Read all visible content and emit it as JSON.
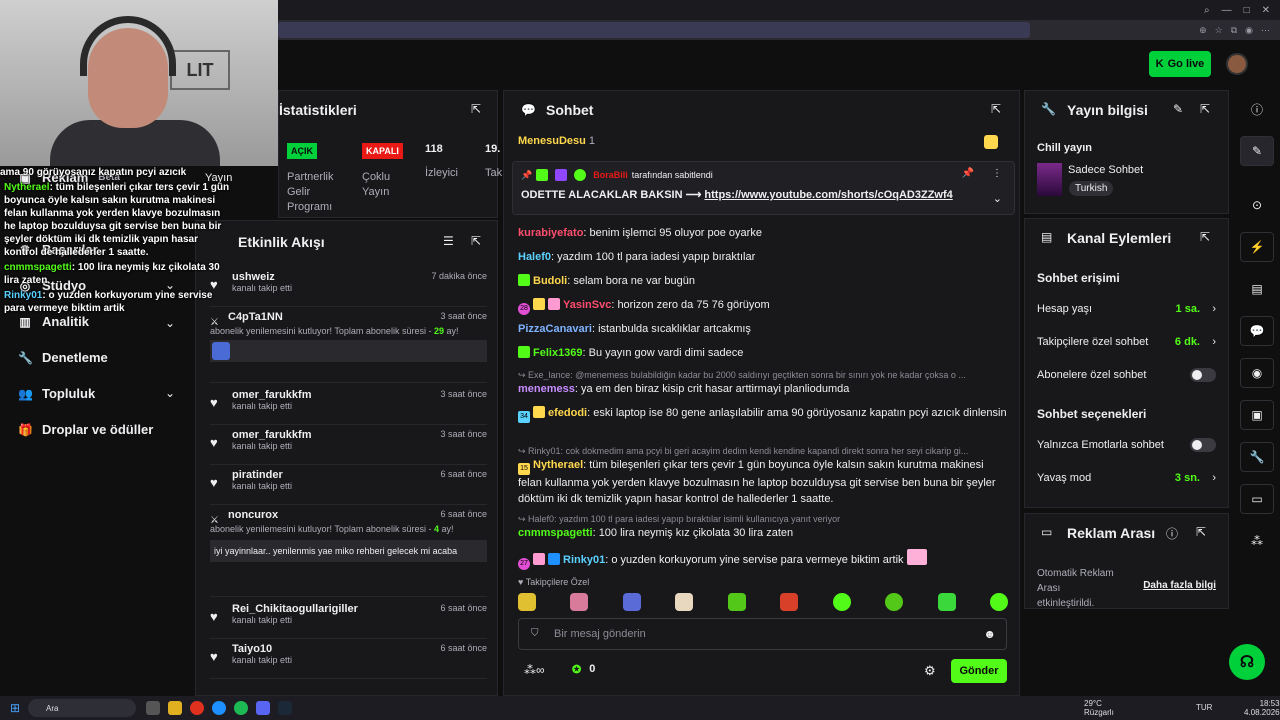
{
  "browser": {
    "icons": [
      "search-icon",
      "minimize-icon",
      "maximize-icon",
      "close-icon"
    ]
  },
  "header": {
    "go_live": "Go live"
  },
  "sidebar": {
    "items": [
      {
        "label": "Reklam",
        "badge": "Beta"
      },
      {
        "label": "Başarılar"
      },
      {
        "label": "Analitik"
      },
      {
        "label": "Stüdyo"
      },
      {
        "label": "Denetleme"
      },
      {
        "label": "Topluluk"
      },
      {
        "label": "Droplar ve ödüller"
      }
    ]
  },
  "overlay_chat": [
    {
      "user": "",
      "text": "ama 90 görüyosanız kapatın pcyi azıcık dinlensin"
    },
    {
      "user": "Nytherael",
      "text": ": tüm bileşenleri çıkar ters çevir 1 gün boyunca öyle kalsın sakın kurutma makinesi felan kullanma yok yerden klavye bozulmasın he laptop bozulduysa git servise ben buna bir şeyler döktüm iki dk temizlik yapın hasar kontrol de hallederler 1 saatte."
    },
    {
      "user": "cnmmspagetti",
      "text": ": 100 lira neymiş kız çikolata 30 lira zaten"
    },
    {
      "user": "Rinky01",
      "text": ": o yuzden korkuyorum yine servise para vermeye biktim artik"
    }
  ],
  "stats": {
    "title": "İstatistikleri",
    "open_badge": "AÇIK",
    "open_label": "Partnerlik Gelir Programı",
    "closed_badge": "KAPALI",
    "closed_label": "Çoklu Yayın",
    "viewers_value": "118",
    "viewers_label": "İzleyici",
    "partial_value": "19.",
    "partial_label": "Tak",
    "overlay_label": "Yayın"
  },
  "activity": {
    "title": "Etkinlik Akışı",
    "items": [
      {
        "name": "ushweiz",
        "sub": "kanalı takip etti",
        "time": "7 dakika önce"
      },
      {
        "name": "C4pTa1NN",
        "sub": "abonelik yenilemesini kutluyor! Toplam abonelik süresi - ",
        "months": "29",
        "suffix": "ay!",
        "time": "3 saat önce"
      },
      {
        "name": "omer_farukkfm",
        "sub": "kanalı takip etti",
        "time": "3 saat önce"
      },
      {
        "name": "omer_farukkfm",
        "sub": "kanalı takip etti",
        "time": "3 saat önce"
      },
      {
        "name": "piratinder",
        "sub": "kanalı takip etti",
        "time": "6 saat önce"
      },
      {
        "name": "noncurox",
        "sub": "abonelik yenilemesini kutluyor! Toplam abonelik süresi - ",
        "months": "4",
        "suffix": "ay!",
        "message": "iyi yayinnlaar.. yenilenmis yae miko rehberi gelecek mi acaba",
        "time": "6 saat önce"
      },
      {
        "name": "Rei_Chikitaogullarigiller",
        "sub": "kanalı takip etti",
        "time": "6 saat önce"
      },
      {
        "name": "Taiyo10",
        "sub": "kanalı takip etti",
        "time": "6 saat önce"
      }
    ]
  },
  "chat": {
    "title": "Sohbet",
    "top_user": "MenesuDesu",
    "top_count": "1",
    "pinned_by": "BoraBili",
    "pinned_suffix": "tarafından sabitlendi",
    "pinned_text": "ODETTE ALACAKLAR BAKSIN ⟶",
    "pinned_link": "https://www.youtube.com/shorts/cOqAD3ZZwf4",
    "messages": [
      {
        "user": "kurabiyefato",
        "color": "#ff4d6d",
        "text": ": benim işlemci 95 oluyor poe oyarke"
      },
      {
        "user": "Halef0",
        "color": "#5ad1ff",
        "text": ": yazdım 100 tl para iadesi yapıp bıraktılar"
      },
      {
        "user": "Budoli",
        "color": "#ffd84d",
        "text": ": selam bora ne var bugün"
      },
      {
        "user": "YasinSvc",
        "color": "#ff4d6d",
        "text": ": horizon zero da 75 76 görüyom",
        "badge_num": "28"
      },
      {
        "user": "PizzaCanavari",
        "color": "#7fb2ff",
        "text": ": istanbulda sıcaklıklar artcakmış"
      },
      {
        "user": "Felix1369",
        "color": "#53fc18",
        "text": ": Bu yayın gow vardi dimi sadece"
      },
      {
        "user": "menemess",
        "color": "#c58cff",
        "text": ": ya em den biraz kisip crit hasar arttirmayi planliodumda",
        "reply": "Exe_lance: @menemess bulabildiğin kadar bu 2000 saldırıyı geçtikten sonra bir sınırı yok ne kadar çoksa o ..."
      },
      {
        "user": "efedodi",
        "color": "#ffd84d",
        "text": ": eski laptop ise 80 gene anlaşılabilir ama 90 görüyosanız kapatın pcyi azıcık dinlensin",
        "badge_num": "34"
      },
      {
        "user": "Nytherael",
        "color": "#ffd84d",
        "text": ": tüm bileşenleri çıkar ters çevir 1 gün boyunca öyle kalsın sakın kurutma makinesi felan kullanma yok yerden klavye bozulmasın he laptop bozulduysa git servise ben buna bir şeyler döktüm iki dk temizlik yapın hasar kontrol de hallederler 1 saatte.",
        "badge_num": "15",
        "reply": "Rinky01: cok dokmedim ama pcyi bi geri acayim dedim kendi kendine kapandi direkt sonra her seyi cikarip gi..."
      },
      {
        "user": "cnmmspagetti",
        "color": "#53fc18",
        "text": ": 100 lira neymiş kız çikolata 30 lira zaten",
        "reply": "Halef0: yazdım 100 tl para iadesi yapıp bıraktılar isimli kullanıcıya yanıt veriyor"
      },
      {
        "user": "Rinky01",
        "color": "#5ad1ff",
        "text": ": o yuzden korkuyorum yine servise para vermeye biktim artik",
        "badge_num": "27"
      }
    ],
    "followers_only": "Takipçilere Özel",
    "input_placeholder": "Bir mesaj gönderin",
    "points": "0",
    "send": "Gönder"
  },
  "stream_info": {
    "title": "Yayın bilgisi",
    "stream_title": "Chill yayın",
    "category": "Sadece Sohbet",
    "language": "Turkish"
  },
  "channel": {
    "title": "Kanal Eylemleri",
    "access_title": "Sohbet erişimi",
    "account_age_label": "Hesap yaşı",
    "account_age_value": "1 sa.",
    "followers_label": "Takipçilere özel sohbet",
    "followers_value": "6 dk.",
    "subs_label": "Abonelere özel sohbet",
    "options_title": "Sohbet seçenekleri",
    "emote_label": "Yalnızca Emotlarla sohbet",
    "slow_label": "Yavaş mod",
    "slow_value": "3 sn."
  },
  "ads": {
    "title": "Reklam Arası",
    "text": "Otomatik Reklam Arası etkinleştirildi.",
    "link": "Daha fazla bilgi"
  },
  "taskbar": {
    "search": "Ara",
    "weather": "29°C",
    "weather_sub": "Rüzgarlı",
    "lang": "TUR",
    "time": "18:53",
    "date": "4.08.2026"
  },
  "colors": {
    "accent": "#53fc18",
    "go_live": "#00d13b",
    "panel": "#18181b",
    "danger": "#e91916"
  }
}
